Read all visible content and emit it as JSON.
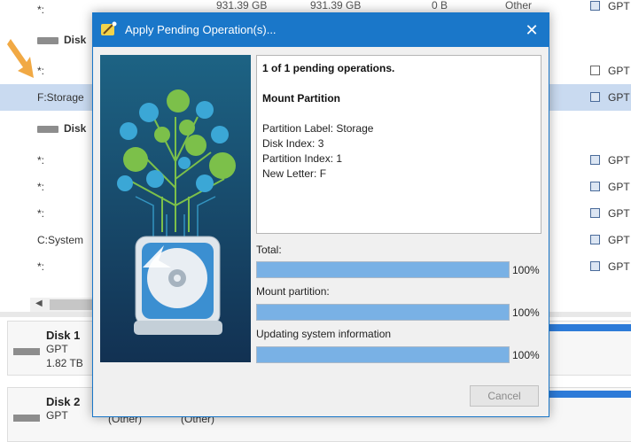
{
  "partitions": {
    "rows": [
      {
        "name": "*:",
        "capacity": "931.39 GB",
        "used": "931.39 GB",
        "unused": "0 B",
        "fs": "Other",
        "type": "GPT"
      },
      {
        "group": "Disk"
      },
      {
        "name": "*:",
        "type": "GPT"
      },
      {
        "name": "F:Storage",
        "type": "GPT",
        "selected": true
      },
      {
        "group": "Disk"
      },
      {
        "name": "*:",
        "type": "GPT"
      },
      {
        "name": "*:",
        "type": "GPT"
      },
      {
        "name": "*:",
        "type": "GPT"
      },
      {
        "name": "C:System",
        "type": "GPT"
      },
      {
        "name": "*:",
        "type": "GPT"
      }
    ]
  },
  "disk_map": {
    "disk1": {
      "name": "Disk 1",
      "type": "GPT",
      "size": "1.82 TB"
    },
    "disk2": {
      "name": "Disk 2",
      "type": "GPT",
      "parts": [
        "(Other)",
        "(Other)"
      ]
    }
  },
  "dialog": {
    "title": "Apply Pending Operation(s)...",
    "close_symbol": "✕",
    "count_text": "1 of 1 pending operations.",
    "operation": "Mount Partition",
    "details": [
      "Partition Label: Storage",
      "Disk Index: 3",
      "Partition Index: 1",
      "New Letter: F"
    ],
    "progress": [
      {
        "label": "Total:",
        "value": 1.0,
        "pct": "100%"
      },
      {
        "label": "Mount partition:",
        "value": 1.0,
        "pct": "100%"
      },
      {
        "label": "Updating system information",
        "value": 1.0,
        "pct": "100%"
      }
    ],
    "cancel_label": "Cancel"
  },
  "colors": {
    "accent": "#1a77c9",
    "progress": "#79b1e5",
    "selected_row": "#c9daf0"
  }
}
